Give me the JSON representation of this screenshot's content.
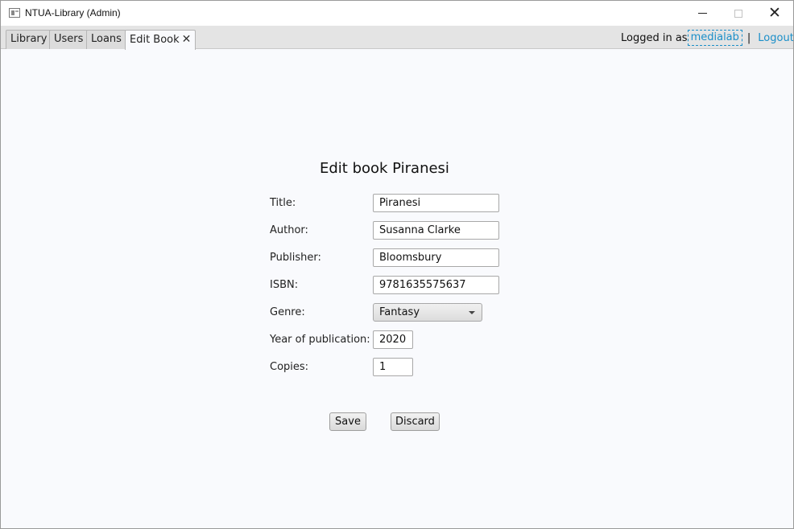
{
  "window": {
    "title": "NTUA-Library (Admin)"
  },
  "tabs": [
    {
      "label": "Library"
    },
    {
      "label": "Users"
    },
    {
      "label": "Loans"
    },
    {
      "label": "Edit Book",
      "close": "✕"
    }
  ],
  "session": {
    "prefix": "Logged in as",
    "username": "medialab",
    "separator": "|",
    "logout": "Logout?"
  },
  "form": {
    "heading": "Edit book Piranesi",
    "fields": {
      "title": {
        "label": "Title:",
        "value": "Piranesi"
      },
      "author": {
        "label": "Author:",
        "value": "Susanna Clarke"
      },
      "publisher": {
        "label": "Publisher:",
        "value": "Bloomsbury"
      },
      "isbn": {
        "label": "ISBN:",
        "value": "9781635575637"
      },
      "genre": {
        "label": "Genre:",
        "value": "Fantasy"
      },
      "year": {
        "label": "Year of publication:",
        "value": "2020"
      },
      "copies": {
        "label": "Copies:",
        "value": "1"
      }
    },
    "save_label": "Save",
    "discard_label": "Discard"
  },
  "colors": {
    "link": "#1a8fc9",
    "content_bg": "#f9fafd",
    "tabbar_bg": "#e4e4e4"
  }
}
